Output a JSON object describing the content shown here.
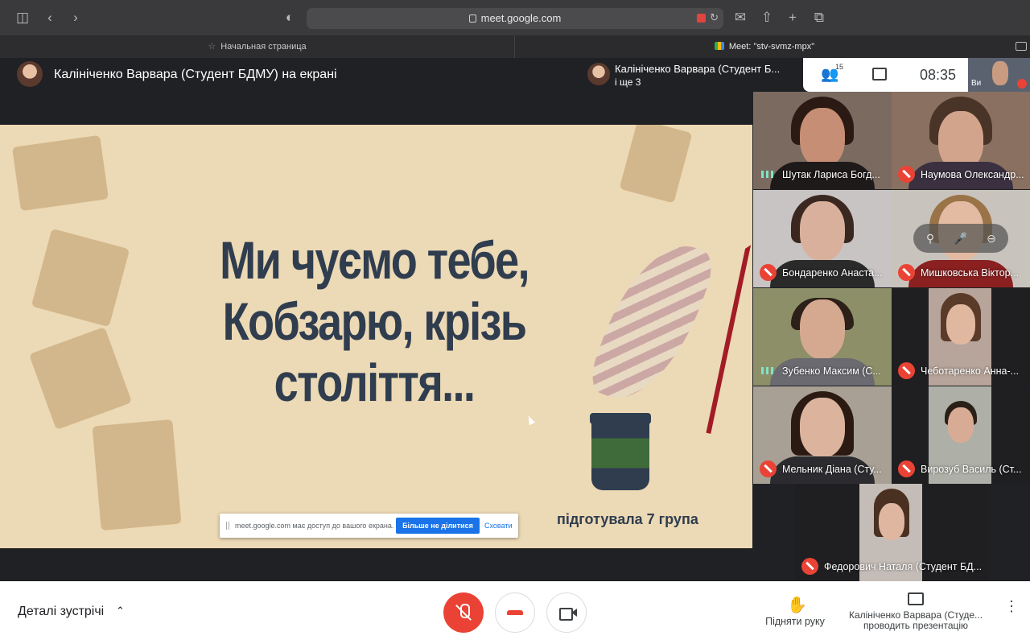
{
  "browser": {
    "url": "meet.google.com",
    "tabs": [
      {
        "label": "Начальная страница"
      },
      {
        "label": "Meet: \"stv-svmz-mpx\""
      }
    ]
  },
  "meet": {
    "presenter_banner": "Калініченко Варвара (Студент БДМУ) на екрані",
    "pinned": {
      "name": "Калініченко Варвара (Студент Б...",
      "more": "і ще 3"
    },
    "people_count": "15",
    "clock": "08:35",
    "self_label": "Ви"
  },
  "slide": {
    "title_lines": [
      "Ми чуємо тебе,",
      "Кобзарю, крізь",
      "століття..."
    ],
    "footer": "підготувала 7 група"
  },
  "share_bar": {
    "text": "meet.google.com має доступ до вашого екрана.",
    "stop_label": "Більше не ділитися",
    "hide_label": "Сховати"
  },
  "participants": [
    {
      "name": "Шутак Лариса Богд...",
      "status": "speaking"
    },
    {
      "name": "Наумова Олександр...",
      "status": "muted"
    },
    {
      "name": "Бондаренко Анаста...",
      "status": "muted"
    },
    {
      "name": "Мишковська Віктор...",
      "status": "muted"
    },
    {
      "name": "Зубенко Максим (С...",
      "status": "speaking"
    },
    {
      "name": "Чеботаренко Анна-...",
      "status": "muted"
    },
    {
      "name": "Мельник Діана (Сту...",
      "status": "muted"
    },
    {
      "name": "Вирозуб Василь (Ст...",
      "status": "muted"
    },
    {
      "name": "Федорович Наталя (Студент БД...",
      "status": "muted"
    }
  ],
  "bottom_bar": {
    "details_label": "Деталі зустрічі",
    "raise_hand_label": "Підняти руку",
    "presenter_label_line1": "Калініченко Варвара (Студе...",
    "presenter_label_line2": "проводить презентацію"
  },
  "colors": {
    "mic_off": "#ea4335",
    "slide_bg": "#ecd9b5",
    "slide_text": "#2f3d4f",
    "accent_blue": "#1a73e8"
  }
}
